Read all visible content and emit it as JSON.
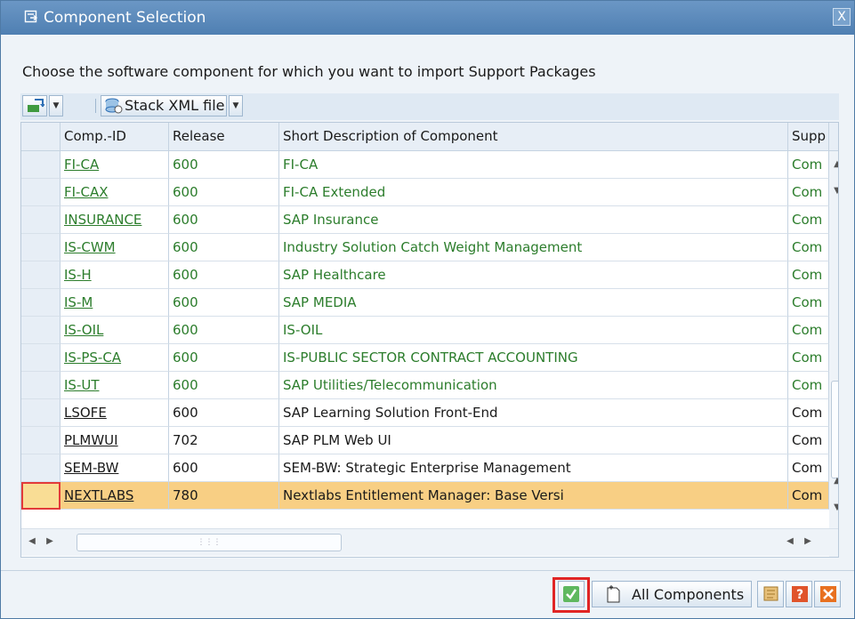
{
  "window": {
    "title": "Component Selection",
    "close_glyph": "X"
  },
  "instruction": "Choose the software component for which you want to import Support Packages",
  "toolbar": {
    "stack_xml_label": "Stack XML file"
  },
  "table": {
    "columns": [
      "Comp.-ID",
      "Release",
      "Short Description of Component",
      "Supp"
    ],
    "rows": [
      {
        "id": "FI-CA",
        "release": "600",
        "desc": "FI-CA",
        "supp": "Com",
        "color": "green"
      },
      {
        "id": "FI-CAX",
        "release": "600",
        "desc": "FI-CA Extended",
        "supp": "Com",
        "color": "green"
      },
      {
        "id": "INSURANCE",
        "release": "600",
        "desc": "SAP Insurance",
        "supp": "Com",
        "color": "green"
      },
      {
        "id": "IS-CWM",
        "release": "600",
        "desc": "Industry Solution Catch Weight Management",
        "supp": "Com",
        "color": "green"
      },
      {
        "id": "IS-H",
        "release": "600",
        "desc": "SAP Healthcare",
        "supp": "Com",
        "color": "green"
      },
      {
        "id": "IS-M",
        "release": "600",
        "desc": "SAP MEDIA",
        "supp": "Com",
        "color": "green"
      },
      {
        "id": "IS-OIL",
        "release": "600",
        "desc": "IS-OIL",
        "supp": "Com",
        "color": "green"
      },
      {
        "id": "IS-PS-CA",
        "release": "600",
        "desc": "IS-PUBLIC SECTOR CONTRACT ACCOUNTING",
        "supp": "Com",
        "color": "green"
      },
      {
        "id": "IS-UT",
        "release": "600",
        "desc": "SAP Utilities/Telecommunication",
        "supp": "Com",
        "color": "green"
      },
      {
        "id": "LSOFE",
        "release": "600",
        "desc": "SAP Learning Solution Front-End",
        "supp": "Com",
        "color": "dark"
      },
      {
        "id": "PLMWUI",
        "release": "702",
        "desc": "SAP PLM Web UI",
        "supp": "Com",
        "color": "dark"
      },
      {
        "id": "SEM-BW",
        "release": "600",
        "desc": "SEM-BW: Strategic Enterprise Management",
        "supp": "Com",
        "color": "dark"
      },
      {
        "id": "NEXTLABS",
        "release": "780",
        "desc": "Nextlabs Entitlement Manager: Base Versi",
        "supp": "Com",
        "color": "dark",
        "highlighted": true
      }
    ]
  },
  "footer": {
    "all_components_label": "All Components"
  },
  "colors": {
    "title_bar": "#5a88b9",
    "green_text": "#2c7d2c",
    "highlight_row": "#f8cf84",
    "focus_outline": "#e02525"
  },
  "icons": [
    "dialog-icon",
    "close-icon",
    "import-icon",
    "stack-xml-icon",
    "checkmark-icon",
    "document-icon",
    "scroll-icon",
    "help-icon",
    "cancel-icon"
  ]
}
